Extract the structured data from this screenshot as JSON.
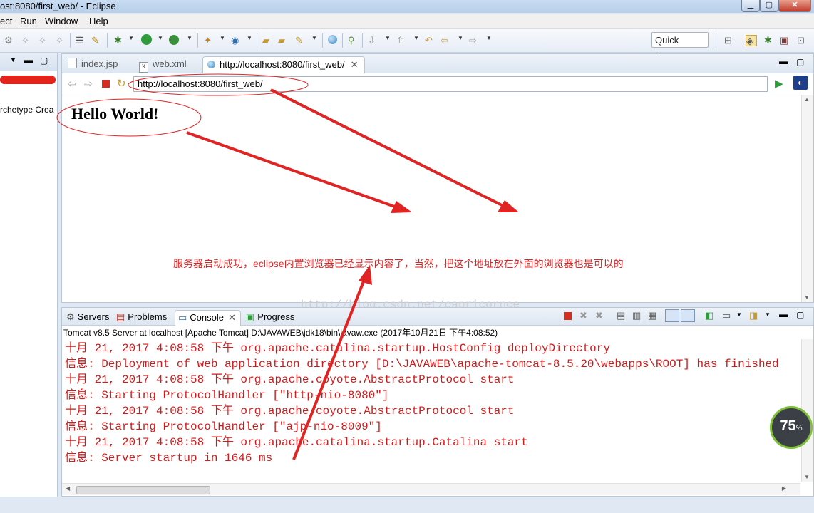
{
  "window": {
    "title": "ost:8080/first_web/ - Eclipse"
  },
  "menu": [
    "ect",
    "Run",
    "Window",
    "Help"
  ],
  "toolbar": {
    "quick_access": "Quick Access"
  },
  "left_pane": {
    "text": "rchetype Crea"
  },
  "editor": {
    "tabs": [
      {
        "label": "index.jsp",
        "icon": "jsp-file-icon"
      },
      {
        "label": "web.xml",
        "icon": "xml-file-icon"
      },
      {
        "label": "http://localhost:8080/first_web/",
        "icon": "globe-icon",
        "active": true
      }
    ],
    "url": "http://localhost:8080/first_web/",
    "page_heading": "Hello World!",
    "annotation": "服务器启动成功，eclipse内置浏览器已经显示内容了，当然，把这个地址放在外面的浏览器也是可以的",
    "watermark": "http://blog.csdn.net/capricornce"
  },
  "console": {
    "tabs": [
      "Servers",
      "Problems",
      "Console",
      "Progress"
    ],
    "info": "Tomcat v8.5 Server at localhost [Apache Tomcat] D:\\JAVAWEB\\jdk18\\bin\\javaw.exe (2017年10月21日 下午4:08:52)",
    "lines": [
      "十月 21, 2017 4:08:58 下午 org.apache.catalina.startup.HostConfig deployDirectory",
      "信息: Deployment of web application directory [D:\\JAVAWEB\\apache-tomcat-8.5.20\\webapps\\ROOT] has finished",
      "十月 21, 2017 4:08:58 下午 org.apache.coyote.AbstractProtocol start",
      "信息: Starting ProtocolHandler [\"http-nio-8080\"]",
      "十月 21, 2017 4:08:58 下午 org.apache.coyote.AbstractProtocol start",
      "信息: Starting ProtocolHandler [\"ajp-nio-8009\"]",
      "十月 21, 2017 4:08:58 下午 org.apache.catalina.startup.Catalina start",
      "信息: Server startup in 1646 ms"
    ]
  },
  "gauge": {
    "value": "75",
    "unit": "%"
  },
  "colors": {
    "annotation_red": "#e02424",
    "console_red": "#d21a1a"
  }
}
